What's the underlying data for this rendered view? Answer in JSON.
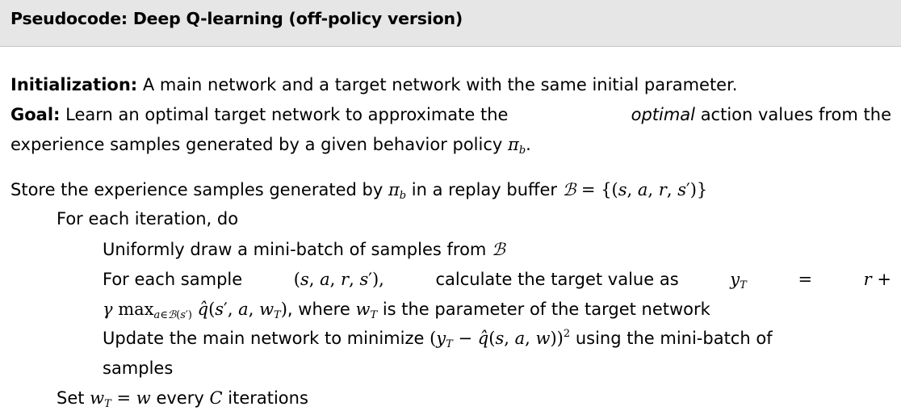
{
  "header": {
    "title": "Pseudocode: Deep Q-learning (off-policy version)"
  },
  "init": {
    "label": "Initialization:",
    "text": "A main network and a target network with the same initial parameter."
  },
  "goal": {
    "label": "Goal:",
    "text_before": "Learn an optimal target network to approximate the",
    "emph": "optimal",
    "text_after": "action values from the",
    "line2_text": "experience samples generated by a given behavior policy"
  },
  "algo": {
    "store_text": "Store the experience samples generated by",
    "store_text2": "in a replay buffer",
    "for_each_iter": "For each iteration, do",
    "draw_text": "Uniformly draw a mini-batch of samples from",
    "for_sample_text": "For each sample",
    "calc_text": "calculate the target value as",
    "where_text": ", where",
    "param_text": "is the parameter of the target network",
    "update_text": "Update the main network to minimize",
    "using_text": "using the mini-batch of",
    "samples_text": "samples",
    "set_text": "Set",
    "every_text": "every",
    "iterations_text": "iterations"
  }
}
